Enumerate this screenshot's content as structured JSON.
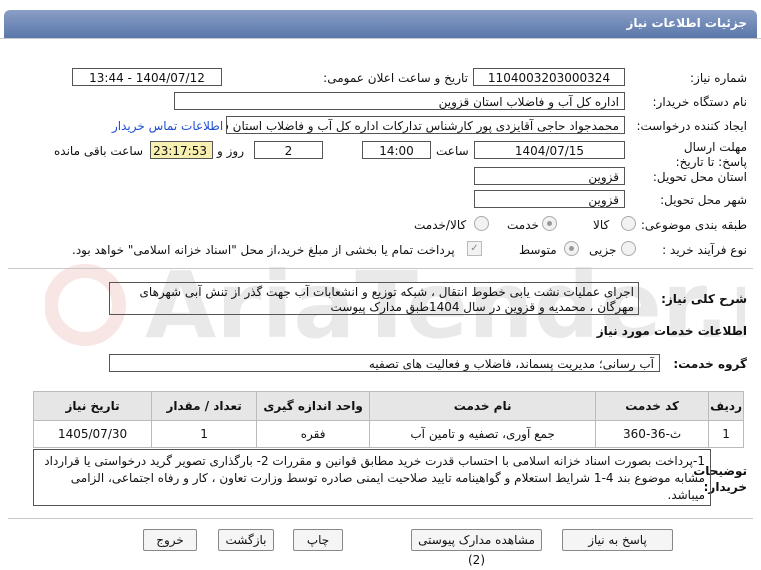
{
  "page": {
    "title": "جزئیات اطلاعات نیاز"
  },
  "watermark": "AriaTender.neT",
  "form": {
    "need_number_label": "شماره نیاز:",
    "need_number": "1104003203000324",
    "announce_label": "تاریخ و ساعت اعلان عمومی:",
    "announce_value": "1404/07/12 - 13:44",
    "buyer_org_label": "نام دستگاه خریدار:",
    "buyer_org": "اداره کل آب و فاضلاب استان قزوین",
    "creator_label": "ایجاد کننده درخواست:",
    "creator": "محمدجواد حاجی آقایزدی پور کارشناس تدارکات اداره کل آب و فاضلاب استان قزوین",
    "contact_link": "اطلاعات تماس خریدار",
    "deadline_label": "مهلت ارسال پاسخ: تا تاریخ:",
    "deadline_date": "1404/07/15",
    "time_label": "ساعت",
    "deadline_time": "14:00",
    "days_value": "2",
    "days_label": "روز و",
    "remaining_time": "23:17:53",
    "remaining_label": "ساعت باقی مانده",
    "province_label": "استان محل تحویل:",
    "province": "قزوین",
    "city_label": "شهر محل تحویل:",
    "city": "قزوین",
    "category_label": "طبقه بندی موضوعی:",
    "category_options": [
      "کالا",
      "خدمت",
      "کالا/خدمت"
    ],
    "category_selected": "خدمت",
    "process_label": "نوع فرآیند خرید :",
    "process_options": [
      "جزیی",
      "متوسط"
    ],
    "process_selected": "متوسط",
    "payment_note": "پرداخت تمام یا بخشی از مبلغ خرید،از محل \"اسناد خزانه اسلامی\" خواهد بود."
  },
  "summary": {
    "label": "شرح کلی نیاز:",
    "text": "اجرای عملیات نشت یابی خطوط انتقال ، شبکه توزیع و انشعابات آب جهت گذر از تنش آبی شهرهای مهرگان ، محمدیه و قزوین در سال 1404طبق مدارک پیوست"
  },
  "services": {
    "heading": "اطلاعات خدمات مورد نیاز",
    "group_label": "گروه خدمت:",
    "group_value": "آب رسانی؛ مدیریت پسماند، فاضلاب و فعالیت های تصفیه",
    "columns": [
      "ردیف",
      "کد خدمت",
      "نام خدمت",
      "واحد اندازه گیری",
      "تعداد / مقدار",
      "تاریخ نیاز"
    ],
    "rows": [
      {
        "row": "1",
        "code": "ث-36-360",
        "name": "جمع آوری، تصفیه و تامین آب",
        "unit": "فقره",
        "qty": "1",
        "date": "1405/07/30"
      }
    ]
  },
  "notes": {
    "label": "توضیحات خریدار:",
    "text": "1-پرداخت بصورت اسناد خزانه اسلامی با احتساب قدرت خرید مطابق قوانین و مقررات 2- بارگذاری تصویر گرید درخواستی یا قرارداد مشابه موضوع بند 4-1 شرایط استعلام و گواهینامه تایید صلاحیت ایمنی صادره توسط وزارت تعاون ، کار و رفاه اجتماعی، الزامی میباشد."
  },
  "buttons": {
    "reply": "پاسخ به نیاز",
    "docs": "مشاهده مدارک پیوستی (2)",
    "print": "چاپ",
    "back": "بازگشت",
    "exit": "خروج"
  }
}
